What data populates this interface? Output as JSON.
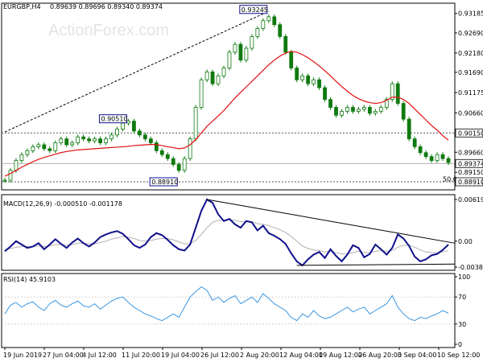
{
  "header": {
    "symbol": "EURGBP,H4",
    "ohlc": "0.89639 0.89696 0.89340 0.89374",
    "watermark": "ActionForex.com"
  },
  "colors": {
    "candle": "#0f7a0f",
    "ma": "#e01010",
    "macd": "#10108c",
    "signal": "#b0b0b0",
    "rsi": "#3a96e0",
    "level": "#555555",
    "label_box": "#10108c"
  },
  "chart_data": [
    {
      "type": "line",
      "panel": "price",
      "ylim": [
        0.8891,
        0.9324
      ],
      "y_ticks": [
        "0.93185",
        "0.92690",
        "0.92180",
        "0.91690",
        "0.91175",
        "0.90660",
        "0.90150",
        "0.89660",
        "0.89374",
        "0.89150",
        "0.88910"
      ],
      "x_ticks": [
        "19 Jun 2019",
        "27 Jun 04:00",
        "4 Jul 12:00",
        "11 Jul 20:00",
        "19 Jul 04:00",
        "26 Jul 12:00",
        "2 Aug 20:00",
        "12 Aug 04:00",
        "19 Aug 12:00",
        "26 Aug 20:00",
        "3 Sep 04:00",
        "10 Sep 12:00"
      ],
      "price_close": [
        0.8895,
        0.892,
        0.8945,
        0.896,
        0.897,
        0.898,
        0.8985,
        0.8975,
        0.897,
        0.899,
        0.9,
        0.8985,
        0.899,
        0.9005,
        0.9,
        0.8995,
        0.9,
        0.899,
        0.9,
        0.901,
        0.9025,
        0.904,
        0.9045,
        0.902,
        0.901,
        0.9,
        0.899,
        0.897,
        0.896,
        0.895,
        0.8935,
        0.892,
        0.895,
        0.9,
        0.908,
        0.915,
        0.917,
        0.914,
        0.916,
        0.918,
        0.922,
        0.924,
        0.92,
        0.923,
        0.926,
        0.928,
        0.93,
        0.931,
        0.929,
        0.926,
        0.922,
        0.918,
        0.915,
        0.916,
        0.914,
        0.915,
        0.913,
        0.91,
        0.908,
        0.906,
        0.907,
        0.908,
        0.907,
        0.9075,
        0.908,
        0.9065,
        0.907,
        0.908,
        0.91,
        0.914,
        0.909,
        0.905,
        0.9,
        0.898,
        0.8965,
        0.8955,
        0.8945,
        0.896,
        0.895,
        0.894
      ],
      "ma": [
        0.8905,
        0.8912,
        0.892,
        0.8928,
        0.8935,
        0.8942,
        0.8948,
        0.8953,
        0.8957,
        0.8961,
        0.8965,
        0.8968,
        0.897,
        0.8972,
        0.8973,
        0.8974,
        0.8975,
        0.8976,
        0.8977,
        0.8978,
        0.8979,
        0.898,
        0.8981,
        0.8983,
        0.8984,
        0.8985,
        0.8986,
        0.8985,
        0.8983,
        0.898,
        0.8978,
        0.8975,
        0.8977,
        0.8985,
        0.8998,
        0.9015,
        0.9032,
        0.9045,
        0.9058,
        0.9072,
        0.9088,
        0.9104,
        0.9118,
        0.9132,
        0.9146,
        0.916,
        0.9174,
        0.9188,
        0.92,
        0.921,
        0.9218,
        0.9222,
        0.922,
        0.9214,
        0.9206,
        0.9196,
        0.9185,
        0.9173,
        0.916,
        0.9146,
        0.9133,
        0.9121,
        0.911,
        0.9102,
        0.9096,
        0.9092,
        0.909,
        0.9092,
        0.9098,
        0.9106,
        0.9106,
        0.91,
        0.909,
        0.9076,
        0.9062,
        0.9048,
        0.9034,
        0.9022,
        0.9008,
        0.8997
      ],
      "labels": [
        {
          "text": "0.93245",
          "value": 0.93245
        },
        {
          "text": "0.90510",
          "value": 0.9051
        },
        {
          "text": "0.88910",
          "value": 0.8891
        }
      ],
      "levels": [
        {
          "text": "0.90150",
          "value": 0.9015
        },
        {
          "text": "0.88910",
          "value": 0.8891
        }
      ],
      "current": {
        "text": "0.89374",
        "value": 0.89374
      },
      "fib_label": "50.0"
    },
    {
      "type": "line",
      "panel": "macd",
      "title": "MACD(12,26,9) -0.000510 -0.001178",
      "ylim": [
        -0.003851,
        0.006195
      ],
      "y_ticks": [
        "0.006195",
        "0.00",
        "-0.003851"
      ],
      "macd": [
        -0.0015,
        -0.0008,
        0.0,
        -0.0005,
        -0.001,
        -0.0008,
        -0.0003,
        -0.0012,
        -0.0005,
        0.0003,
        -0.0004,
        -0.001,
        -0.0002,
        0.0004,
        -0.0003,
        -0.0008,
        -0.0002,
        0.0006,
        0.001,
        0.0013,
        0.0015,
        0.0011,
        0.0003,
        -0.0006,
        -0.001,
        -0.0005,
        0.0006,
        0.0012,
        0.0009,
        0.0002,
        -0.0006,
        -0.0012,
        -0.0014,
        -0.0005,
        0.002,
        0.0045,
        0.0062,
        0.0057,
        0.004,
        0.003,
        0.0033,
        0.0025,
        0.002,
        0.003,
        0.0028,
        0.0016,
        0.0023,
        0.0012,
        0.0008,
        0.0003,
        -0.0004,
        -0.0018,
        -0.003,
        -0.0036,
        -0.0027,
        -0.002,
        -0.0016,
        -0.0025,
        -0.0012,
        -0.0022,
        -0.003,
        -0.002,
        -0.0006,
        -0.001,
        -0.0024,
        -0.0019,
        -0.0005,
        -0.0012,
        -0.002,
        -0.001,
        0.001,
        0.0004,
        -0.0007,
        -0.0023,
        -0.003,
        -0.0027,
        -0.0021,
        -0.0019,
        -0.0013,
        -0.0005
      ],
      "signal": [
        -0.0012,
        -0.0011,
        -0.0009,
        -0.0008,
        -0.0008,
        -0.0008,
        -0.0007,
        -0.0008,
        -0.0007,
        -0.0005,
        -0.0005,
        -0.0006,
        -0.0005,
        -0.0003,
        -0.0003,
        -0.0004,
        -0.0004,
        -0.0002,
        0.0,
        0.0003,
        0.0005,
        0.0007,
        0.0006,
        0.0004,
        0.0001,
        0.0,
        0.0001,
        0.0003,
        0.0004,
        0.0004,
        0.0002,
        -0.0001,
        -0.0004,
        -0.0004,
        0.0001,
        0.001,
        0.002,
        0.0028,
        0.0031,
        0.0031,
        0.0032,
        0.0031,
        0.0029,
        0.0029,
        0.0029,
        0.0026,
        0.0025,
        0.0023,
        0.002,
        0.0017,
        0.0013,
        0.0007,
        0.0,
        -0.0007,
        -0.0011,
        -0.0013,
        -0.0014,
        -0.0016,
        -0.0015,
        -0.0017,
        -0.0019,
        -0.0019,
        -0.0017,
        -0.0015,
        -0.0017,
        -0.0017,
        -0.0015,
        -0.0014,
        -0.0015,
        -0.0014,
        -0.0009,
        -0.0006,
        -0.0006,
        -0.0009,
        -0.0013,
        -0.0016,
        -0.0017,
        -0.0017,
        -0.0016,
        -0.0014
      ]
    },
    {
      "type": "line",
      "panel": "rsi",
      "title": "RSI(14) 45.9103",
      "ylim": [
        0,
        100
      ],
      "y_ticks": [
        "100",
        "70",
        "30",
        "0"
      ],
      "rsi": [
        45,
        58,
        62,
        55,
        60,
        63,
        55,
        50,
        60,
        65,
        58,
        55,
        60,
        64,
        57,
        55,
        60,
        52,
        58,
        64,
        68,
        70,
        62,
        55,
        50,
        45,
        42,
        38,
        35,
        40,
        45,
        40,
        55,
        70,
        78,
        85,
        80,
        65,
        70,
        62,
        68,
        72,
        60,
        65,
        70,
        62,
        75,
        68,
        60,
        55,
        50,
        40,
        35,
        45,
        40,
        50,
        42,
        38,
        40,
        45,
        50,
        55,
        48,
        52,
        55,
        45,
        50,
        55,
        60,
        72,
        55,
        45,
        38,
        35,
        40,
        38,
        42,
        45,
        50,
        46
      ]
    }
  ]
}
